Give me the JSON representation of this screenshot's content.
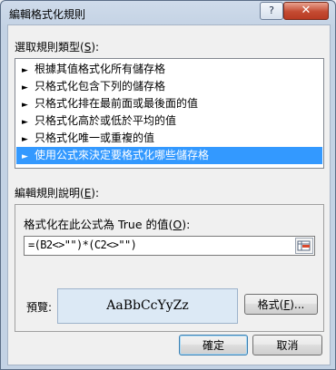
{
  "window": {
    "title": "編輯格式化規則"
  },
  "titlebar": {
    "help_label": "?",
    "close_label": "✕"
  },
  "rule_type": {
    "label_prefix": "選取規則類型(",
    "label_key": "S",
    "label_suffix": "):",
    "items": [
      {
        "label": "根據其值格式化所有儲存格",
        "selected": false
      },
      {
        "label": "只格式化包含下列的儲存格",
        "selected": false
      },
      {
        "label": "只格式化排在最前面或最後面的值",
        "selected": false
      },
      {
        "label": "只格式化高於或低於平均的值",
        "selected": false
      },
      {
        "label": "只格式化唯一或重複的值",
        "selected": false
      },
      {
        "label": "使用公式來決定要格式化哪些儲存格",
        "selected": true
      }
    ],
    "arrow_glyph": "►"
  },
  "description": {
    "label_prefix": "編輯規則說明(",
    "label_key": "E",
    "label_suffix": "):",
    "formula_label_prefix": "格式化在此公式為 True 的值(",
    "formula_label_key": "O",
    "formula_label_suffix": "):",
    "formula_value": "=(B2<>\"\")*(C2<>\"\")",
    "preview_label": "預覽:",
    "preview_text": "AaBbCcYyZz",
    "format_button_prefix": "格式(",
    "format_button_key": "F",
    "format_button_suffix": ")..."
  },
  "buttons": {
    "ok": "確定",
    "cancel": "取消"
  }
}
